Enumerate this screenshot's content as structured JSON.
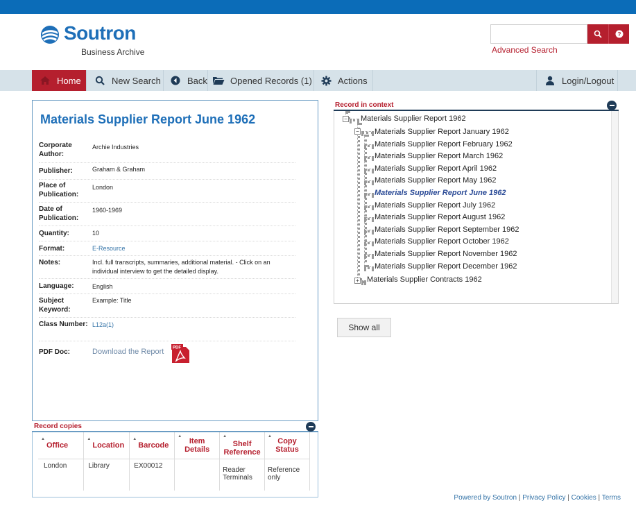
{
  "header": {
    "brand_name": "Soutron",
    "brand_sub": "Business Archive",
    "search_placeholder": "",
    "advanced_search": "Advanced Search",
    "colors": {
      "top_bar": "#0b6cb8",
      "accent": "#b51f2e",
      "brand": "#1e6fb8"
    }
  },
  "nav": {
    "home": "Home",
    "new_search": "New Search",
    "back": "Back",
    "opened_records": "Opened Records (1)",
    "actions": "Actions",
    "login": "Login/Logout"
  },
  "record": {
    "title": "Materials Supplier Report June 1962",
    "fields": [
      {
        "label": "Corporate Author:",
        "value": "Archie Industries"
      },
      {
        "label": "Publisher:",
        "value": "Graham & Graham"
      },
      {
        "label": "Place of Publication:",
        "value": "London"
      },
      {
        "label": "Date of Publication:",
        "value": "1960-1969"
      },
      {
        "label": "Quantity:",
        "value": "10"
      },
      {
        "label": "Format:",
        "value": "E-Resource"
      },
      {
        "label": "Notes:",
        "value": "Incl. full transcripts, summaries, additional material. - Click on an individual interview to get the detailed display."
      },
      {
        "label": "Language:",
        "value": "English"
      },
      {
        "label": "Subject Keyword:",
        "value": "Example: Title"
      },
      {
        "label": "Class Number:",
        "value": "L12a(1)"
      },
      {
        "label": "PDF Doc:",
        "value": "Download the Report"
      }
    ]
  },
  "copies": {
    "title": "Record copies",
    "columns": [
      "Office",
      "Location",
      "Barcode",
      "Item Details",
      "Shelf Reference",
      "Copy Status"
    ],
    "rows": [
      [
        "London",
        "Library",
        "EX00012",
        "",
        "Reader Terminals",
        "Reference only"
      ]
    ]
  },
  "context": {
    "title": "Record in context",
    "root": "Materials Supplier Report 1962",
    "children": [
      "Materials Supplier Report January 1962",
      "Materials Supplier Report February 1962",
      "Materials Supplier Report March 1962",
      "Materials Supplier Report April 1962",
      "Materials Supplier Report May 1962",
      "Materials Supplier Report June 1962",
      "Materials Supplier Report July 1962",
      "Materials Supplier Report August 1962",
      "Materials Supplier Report September 1962",
      "Materials Supplier Report October 1962",
      "Materials Supplier Report November 1962",
      "Materials Supplier Report December 1962"
    ],
    "sibling": "Materials Supplier Contracts 1962",
    "active_index": 5,
    "show_all": "Show all"
  },
  "footer": {
    "powered": "Powered by Soutron",
    "privacy": "Privacy Policy",
    "cookies": "Cookies",
    "terms": "Terms"
  }
}
